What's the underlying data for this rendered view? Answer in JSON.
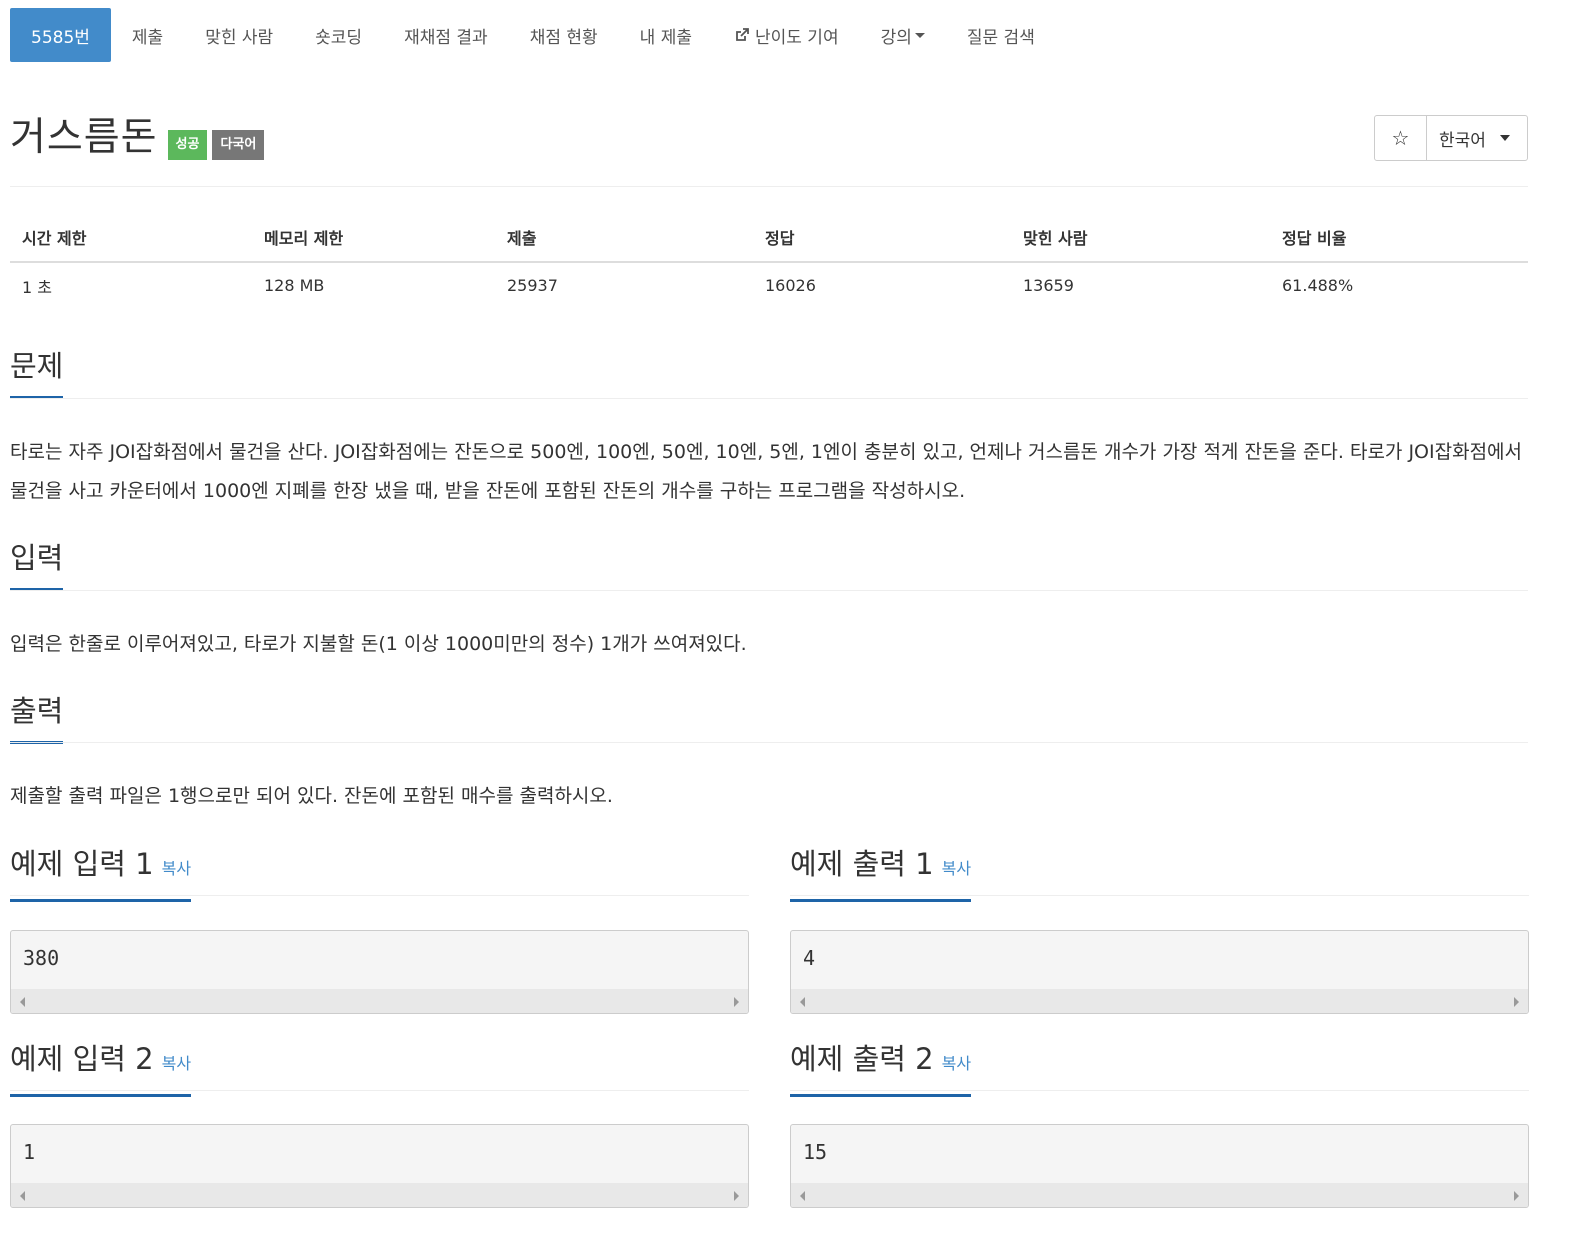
{
  "nav": {
    "tabs": [
      {
        "label": "5585번",
        "active": true
      },
      {
        "label": "제출"
      },
      {
        "label": "맞힌 사람"
      },
      {
        "label": "숏코딩"
      },
      {
        "label": "재채점 결과"
      },
      {
        "label": "채점 현황"
      },
      {
        "label": "내 제출"
      },
      {
        "label": "난이도 기여",
        "icon": "external-link-icon"
      },
      {
        "label": "강의",
        "icon": "caret-down-icon"
      },
      {
        "label": "질문 검색"
      }
    ]
  },
  "problem": {
    "title": "거스름돈",
    "badges": {
      "success": "성공",
      "multilang": "다국어"
    },
    "star_icon": "☆",
    "language": "한국어"
  },
  "info": {
    "headers": [
      "시간 제한",
      "메모리 제한",
      "제출",
      "정답",
      "맞힌 사람",
      "정답 비율"
    ],
    "values": [
      "1 초",
      "128 MB",
      "25937",
      "16026",
      "13659",
      "61.488%"
    ]
  },
  "sections": {
    "problem": {
      "heading": "문제",
      "text": "타로는 자주 JOI잡화점에서 물건을 산다. JOI잡화점에는 잔돈으로 500엔, 100엔, 50엔, 10엔, 5엔, 1엔이 충분히 있고, 언제나 거스름돈 개수가 가장 적게 잔돈을 준다. 타로가 JOI잡화점에서 물건을 사고 카운터에서 1000엔 지폐를 한장 냈을 때, 받을 잔돈에 포함된 잔돈의 개수를 구하는 프로그램을 작성하시오."
    },
    "input": {
      "heading": "입력",
      "text": "입력은 한줄로 이루어져있고, 타로가 지불할 돈(1 이상 1000미만의 정수) 1개가 쓰여져있다."
    },
    "output": {
      "heading": "출력",
      "text": "제출할 출력 파일은 1행으로만 되어 있다. 잔돈에 포함된 매수를 출력하시오."
    }
  },
  "samples": {
    "copy_label": "복사",
    "in1": {
      "heading": "예제 입력 1",
      "value": "380"
    },
    "out1": {
      "heading": "예제 출력 1",
      "value": "4"
    },
    "in2": {
      "heading": "예제 입력 2",
      "value": "1"
    },
    "out2": {
      "heading": "예제 출력 2",
      "value": "15"
    }
  },
  "colors": {
    "active_tab": "#428bca",
    "success_badge": "#5cb85c",
    "multilang_badge": "#777777",
    "section_underline": "#1e64a8",
    "link": "#428bca"
  }
}
